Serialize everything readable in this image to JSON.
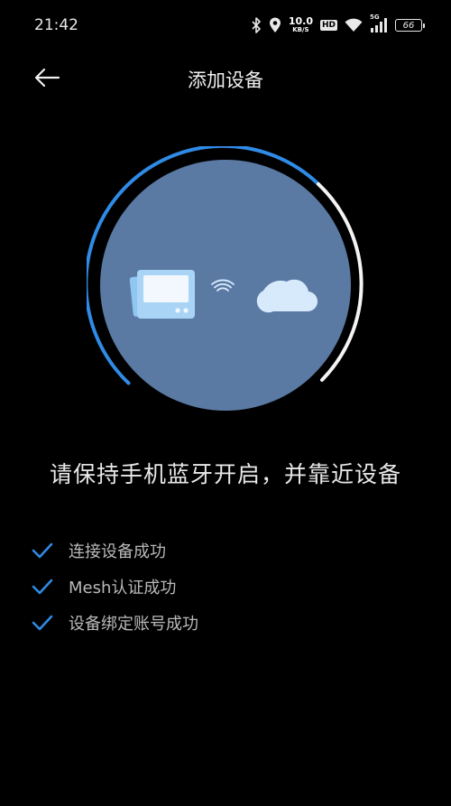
{
  "status_bar": {
    "time": "21:42",
    "net_speed_value": "10.0",
    "net_speed_unit": "KB/S",
    "hd_label": "HD",
    "signal_label": "5G",
    "battery_level": "66",
    "icons": [
      "bluetooth-icon",
      "location-icon",
      "wifi-icon",
      "cell-signal-icon",
      "battery-icon"
    ]
  },
  "header": {
    "title": "添加设备",
    "back_icon": "arrow-left-icon"
  },
  "illustration": {
    "icons": [
      "gateway-device-icon",
      "wifi-waves-icon",
      "cloud-icon"
    ],
    "progress_ring_color": "#2f8be5",
    "circle_color": "#5a79a3"
  },
  "instruction": "请保持手机蓝牙开启，并靠近设备",
  "steps": [
    {
      "label": "连接设备成功",
      "done": true
    },
    {
      "label": "Mesh认证成功",
      "done": true
    },
    {
      "label": "设备绑定账号成功",
      "done": true
    }
  ],
  "colors": {
    "background": "#000000",
    "accent": "#2f8be5",
    "text_primary": "#e8e8e8",
    "text_secondary": "#b9b9b9"
  }
}
